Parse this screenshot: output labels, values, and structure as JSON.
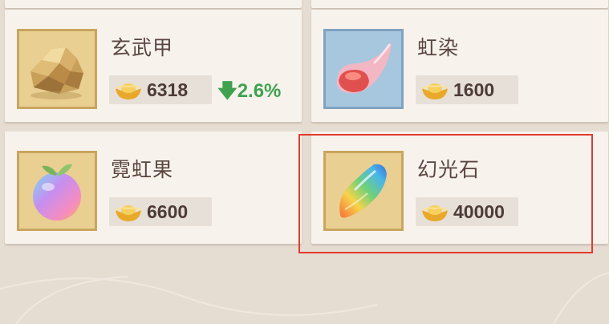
{
  "items": [
    {
      "name": "玄武甲",
      "price": "6318",
      "trend": "2.6%",
      "trend_dir": "down",
      "icon": "gold-rock-icon"
    },
    {
      "name": "虹染",
      "price": "1600",
      "icon": "pink-shell-icon"
    },
    {
      "name": "霓虹果",
      "price": "6600",
      "icon": "rainbow-fruit-icon"
    },
    {
      "name": "幻光石",
      "price": "40000",
      "icon": "prism-stone-icon",
      "selected": true
    }
  ],
  "colors": {
    "trend_down": "#3fa24f",
    "selection_border": "#e23a2e",
    "gold_frame": "#e9cf91",
    "blue_frame": "#a7c7de"
  }
}
